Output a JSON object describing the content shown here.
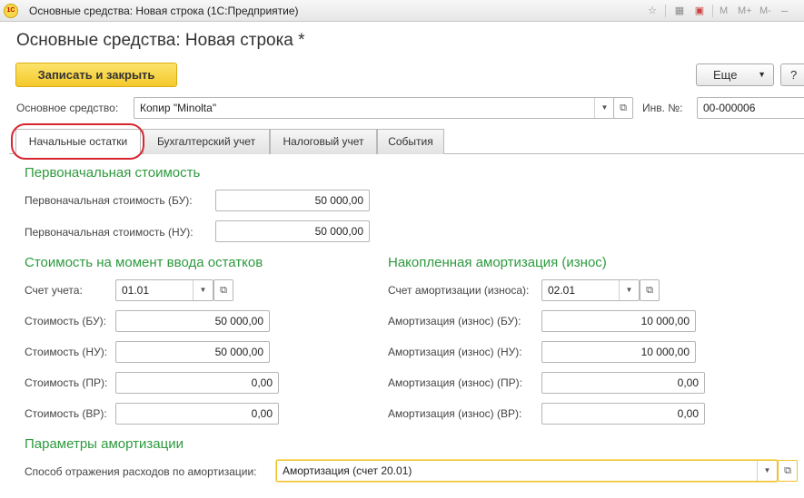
{
  "window": {
    "title": "Основные средства: Новая строка  (1С:Предприятие)",
    "toolbar": {
      "m": "M",
      "m_plus": "M+",
      "m_minus": "M-"
    }
  },
  "form": {
    "title": "Основные средства: Новая строка *",
    "save_close_label": "Записать и закрыть",
    "more_label": "Еще",
    "help_label": "?"
  },
  "asset": {
    "label": "Основное средство:",
    "value": "Копир \"Minolta\"",
    "inv_label": "Инв. №:",
    "inv_value": "00-000006"
  },
  "tabs": [
    {
      "label": "Начальные остатки",
      "active": true
    },
    {
      "label": "Бухгалтерский учет",
      "active": false
    },
    {
      "label": "Налоговый учет",
      "active": false
    },
    {
      "label": "События",
      "active": false
    }
  ],
  "initial_cost": {
    "heading": "Первоначальная стоимость",
    "bu_label": "Первоначальная стоимость (БУ):",
    "bu_value": "50 000,00",
    "nu_label": "Первоначальная стоимость (НУ):",
    "nu_value": "50 000,00"
  },
  "balance_cost": {
    "heading": "Стоимость на момент ввода остатков",
    "account_label": "Счет учета:",
    "account_value": "01.01",
    "bu_label": "Стоимость (БУ):",
    "bu_value": "50 000,00",
    "nu_label": "Стоимость (НУ):",
    "nu_value": "50 000,00",
    "pr_label": "Стоимость (ПР):",
    "pr_value": "0,00",
    "vr_label": "Стоимость (ВР):",
    "vr_value": "0,00"
  },
  "depreciation": {
    "heading": "Накопленная амортизация (износ)",
    "account_label": "Счет амортизации (износа):",
    "account_value": "02.01",
    "bu_label": "Амортизация (износ) (БУ):",
    "bu_value": "10 000,00",
    "nu_label": "Амортизация (износ) (НУ):",
    "nu_value": "10 000,00",
    "pr_label": "Амортизация (износ) (ПР):",
    "pr_value": "0,00",
    "vr_label": "Амортизация (износ) (ВР):",
    "vr_value": "0,00"
  },
  "params": {
    "heading": "Параметры амортизации",
    "method_label": "Способ отражения расходов по амортизации:",
    "method_value": "Амортизация (счет 20.01)"
  },
  "colors": {
    "section_heading": "#2d9a3e",
    "save_button": "#f4c92c",
    "tab_annotation": "#d8262e"
  }
}
